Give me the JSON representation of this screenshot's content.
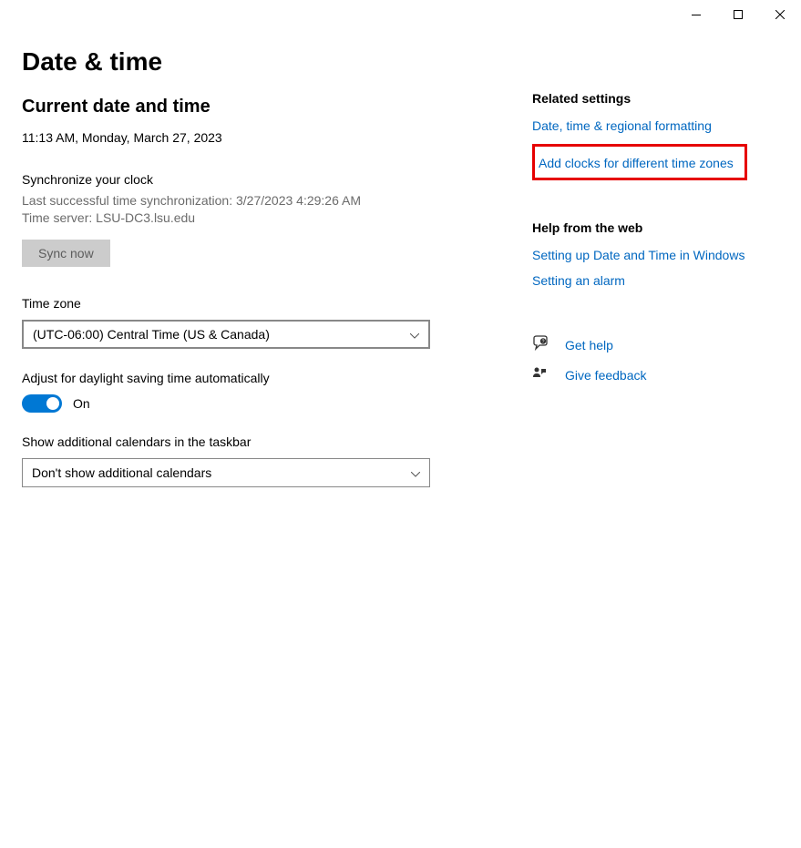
{
  "header": {
    "title": "Date & time"
  },
  "currentDateTime": {
    "heading": "Current date and time",
    "value": "11:13 AM, Monday, March 27, 2023"
  },
  "sync": {
    "heading": "Synchronize your clock",
    "lastSync": "Last successful time synchronization: 3/27/2023 4:29:26 AM",
    "server": "Time server: LSU-DC3.lsu.edu",
    "buttonLabel": "Sync now"
  },
  "timezone": {
    "label": "Time zone",
    "value": "(UTC-06:00) Central Time (US & Canada)"
  },
  "dst": {
    "label": "Adjust for daylight saving time automatically",
    "state": "On"
  },
  "calendars": {
    "label": "Show additional calendars in the taskbar",
    "value": "Don't show additional calendars"
  },
  "related": {
    "heading": "Related settings",
    "link1": "Date, time & regional formatting",
    "link2": "Add clocks for different time zones"
  },
  "help": {
    "heading": "Help from the web",
    "link1": "Setting up Date and Time in Windows",
    "link2": "Setting an alarm"
  },
  "footerLinks": {
    "getHelp": "Get help",
    "giveFeedback": "Give feedback"
  }
}
